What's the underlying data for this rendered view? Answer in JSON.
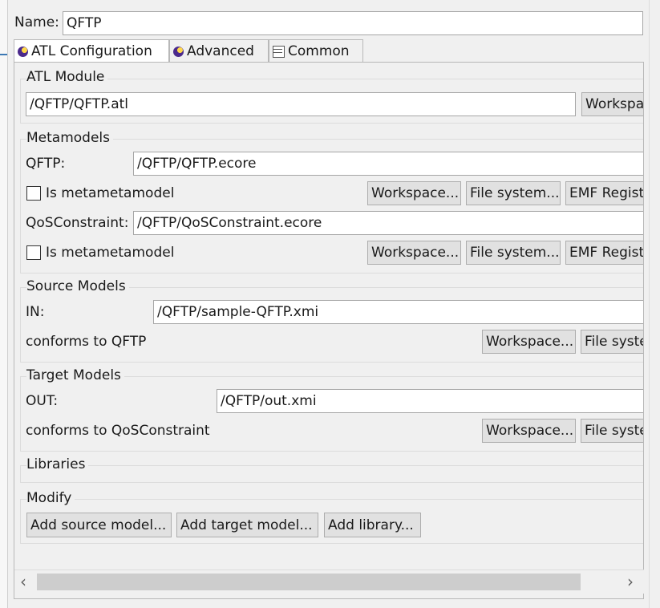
{
  "name": {
    "label": "Name:",
    "value": "QFTP"
  },
  "tabs": [
    {
      "label": "ATL Configuration",
      "icon": "atl-icon",
      "active": true
    },
    {
      "label": "Advanced",
      "icon": "atl-icon",
      "active": false
    },
    {
      "label": "Common",
      "icon": "common-tab-icon",
      "active": false
    }
  ],
  "atl_module": {
    "title": "ATL Module",
    "path": "/QFTP/QFTP.atl",
    "workspace_label": "Workspace..."
  },
  "metamodels": {
    "title": "Metamodels",
    "items": [
      {
        "name": "QFTP:",
        "path": "/QFTP/QFTP.ecore",
        "checkbox_label": "Is metametamodel",
        "checked": false
      },
      {
        "name": "QoSConstraint:",
        "path": "/QFTP/QoSConstraint.ecore",
        "checkbox_label": "Is metametamodel",
        "checked": false
      }
    ],
    "buttons": {
      "workspace": "Workspace...",
      "file_system": "File system...",
      "emf_registry": "EMF Registry..."
    }
  },
  "source_models": {
    "title": "Source Models",
    "name": "IN:",
    "path": "/QFTP/sample-QFTP.xmi",
    "conforms": "conforms to QFTP",
    "buttons": {
      "workspace": "Workspace...",
      "file_system": "File system..."
    }
  },
  "target_models": {
    "title": "Target Models",
    "name": "OUT:",
    "path": "/QFTP/out.xmi",
    "conforms": "conforms to QoSConstraint",
    "buttons": {
      "workspace": "Workspace...",
      "file_system": "File system..."
    }
  },
  "libraries": {
    "title": "Libraries"
  },
  "modify": {
    "title": "Modify",
    "buttons": {
      "add_source": "Add source model...",
      "add_target": "Add target model...",
      "add_library": "Add library..."
    }
  },
  "scrollbar": {
    "left_arrow": "‹",
    "right_arrow": "›"
  },
  "colors": {
    "background": "#f0f0f0",
    "field_border": "#a6a6a6",
    "button_bg": "#e1e1e1",
    "link_blue": "#3c78b4"
  }
}
